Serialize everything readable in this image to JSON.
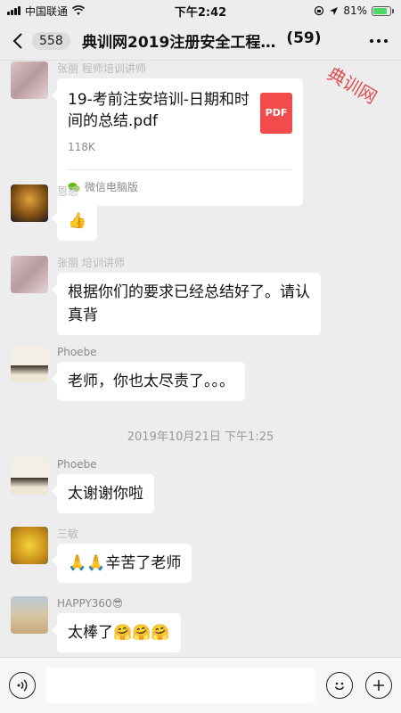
{
  "status_bar": {
    "carrier": "中国联通",
    "time": "下午2:42",
    "battery": "81%",
    "battery_level": 0.81
  },
  "nav": {
    "back_count": "558",
    "title": "典训网2019注册安全工程…",
    "member_count": "(59)"
  },
  "watermark": "典训网",
  "messages": [
    {
      "sender": "张丽 程师培训讲师",
      "type": "file",
      "file_name": "19-考前注安培训-日期和时间的总结.pdf",
      "file_size": "118K",
      "file_icon_label": "PDF",
      "file_source": "微信电脑版"
    },
    {
      "sender": "恩怒",
      "type": "sticker",
      "content": "👍"
    },
    {
      "sender": "张丽 培训讲师",
      "type": "text",
      "content": "根据你们的要求已经总结好了。请认真背"
    },
    {
      "sender": "Phoebe",
      "type": "text",
      "content": "老师，你也太尽责了。。。"
    },
    {
      "sender": "Phoebe",
      "type": "text",
      "content": "太谢谢你啦"
    },
    {
      "sender": "三敏",
      "type": "text",
      "content": "🙏🙏辛苦了老师"
    },
    {
      "sender": "HAPPY360😎",
      "type": "text",
      "content": "太棒了🤗🤗🤗"
    }
  ],
  "time_divider": "2019年10月21日 下午1:25",
  "input_bar": {
    "voice_icon": "voice-icon",
    "emoji_icon": "emoji-icon",
    "plus_icon": "plus-icon"
  },
  "colors": {
    "background": "#ededed",
    "bubble": "#ffffff",
    "pdf_red": "#f14b4b",
    "battery_green": "#4cd964"
  }
}
